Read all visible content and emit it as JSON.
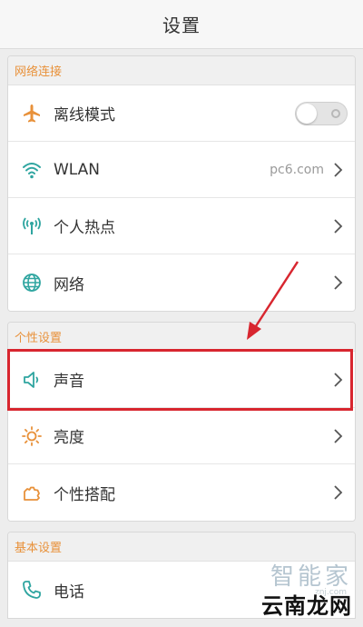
{
  "header": {
    "title": "设置"
  },
  "sections": [
    {
      "header": "网络连接",
      "items": [
        {
          "label": "离线模式",
          "icon": "airplane-icon",
          "control": "toggle",
          "toggle_on": false
        },
        {
          "label": "WLAN",
          "icon": "wifi-icon",
          "value": "pc6.com"
        },
        {
          "label": "个人热点",
          "icon": "hotspot-icon"
        },
        {
          "label": "网络",
          "icon": "globe-icon"
        }
      ]
    },
    {
      "header": "个性设置",
      "items": [
        {
          "label": "声音",
          "icon": "speaker-icon"
        },
        {
          "label": "亮度",
          "icon": "brightness-icon"
        },
        {
          "label": "个性搭配",
          "icon": "puzzle-icon"
        }
      ]
    },
    {
      "header": "基本设置",
      "items": [
        {
          "label": "电话",
          "icon": "phone-icon"
        }
      ]
    }
  ],
  "watermark": {
    "line1": "智能家",
    "line2": "znj.com",
    "main": "云南龙网"
  },
  "colors": {
    "accent_orange": "#e8913a",
    "accent_teal": "#2fa5a0",
    "highlight_red": "#d8262f",
    "section_header_text": "#e8913a"
  }
}
